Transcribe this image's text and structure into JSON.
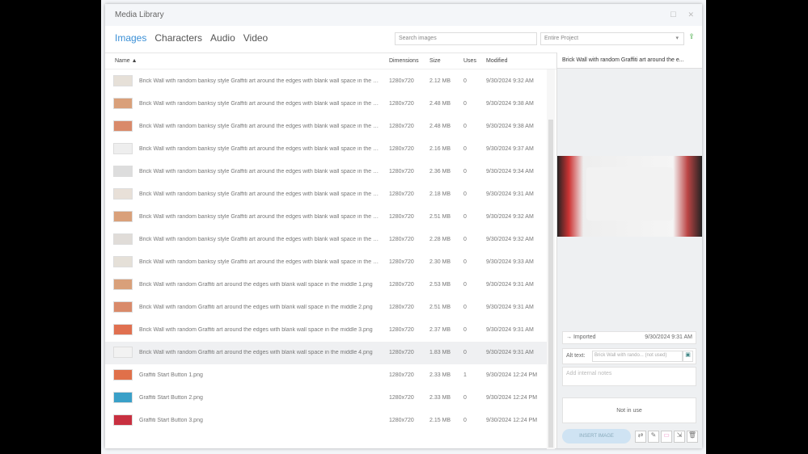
{
  "window": {
    "title": "Media Library",
    "maximize": "☐",
    "close": "✕"
  },
  "tabs": [
    {
      "label": "Images"
    },
    {
      "label": "Characters"
    },
    {
      "label": "Audio"
    },
    {
      "label": "Video"
    }
  ],
  "search": {
    "placeholder": "Search images"
  },
  "scope": {
    "value": "Entire Project"
  },
  "columns": {
    "name": "Name ▲",
    "dimensions": "Dimensions",
    "size": "Size",
    "uses": "Uses",
    "modified": "Modified"
  },
  "rows": [
    {
      "name": "Brick Wall with random banksy style Graffiti art around the edges with blank wall space in the mic...",
      "dim": "1280x720",
      "size": "2.12 MB",
      "uses": "0",
      "mod": "9/30/2024 9:32 AM"
    },
    {
      "name": "Brick Wall with random banksy style Graffiti art around the edges with blank wall space in the mic...",
      "dim": "1280x720",
      "size": "2.48 MB",
      "uses": "0",
      "mod": "9/30/2024 9:38 AM"
    },
    {
      "name": "Brick Wall with random banksy style Graffiti art around the edges with blank wall space in the mic...",
      "dim": "1280x720",
      "size": "2.48 MB",
      "uses": "0",
      "mod": "9/30/2024 9:38 AM"
    },
    {
      "name": "Brick Wall with random banksy style Graffiti art around the edges with blank wall space in the mic...",
      "dim": "1280x720",
      "size": "2.16 MB",
      "uses": "0",
      "mod": "9/30/2024 9:37 AM"
    },
    {
      "name": "Brick Wall with random banksy style Graffiti art around the edges with blank wall space in the mic...",
      "dim": "1280x720",
      "size": "2.36 MB",
      "uses": "0",
      "mod": "9/30/2024 9:34 AM"
    },
    {
      "name": "Brick Wall with random banksy style Graffiti art around the edges with blank wall space in the mic...",
      "dim": "1280x720",
      "size": "2.18 MB",
      "uses": "0",
      "mod": "9/30/2024 9:31 AM"
    },
    {
      "name": "Brick Wall with random banksy style Graffiti art around the edges with blank wall space in the mic...",
      "dim": "1280x720",
      "size": "2.51 MB",
      "uses": "0",
      "mod": "9/30/2024 9:32 AM"
    },
    {
      "name": "Brick Wall with random banksy style Graffiti art around the edges with blank wall space in the mic...",
      "dim": "1280x720",
      "size": "2.28 MB",
      "uses": "0",
      "mod": "9/30/2024 9:32 AM"
    },
    {
      "name": "Brick Wall with random banksy style Graffiti art around the edges with blank wall space in the mic...",
      "dim": "1280x720",
      "size": "2.30 MB",
      "uses": "0",
      "mod": "9/30/2024 9:33 AM"
    },
    {
      "name": "Brick Wall with random Graffiti art around the edges with blank wall space in the middle 1.png",
      "dim": "1280x720",
      "size": "2.53 MB",
      "uses": "0",
      "mod": "9/30/2024 9:31 AM"
    },
    {
      "name": "Brick Wall with random Graffiti art around the edges with blank wall space in the middle 2.png",
      "dim": "1280x720",
      "size": "2.51 MB",
      "uses": "0",
      "mod": "9/30/2024 9:31 AM"
    },
    {
      "name": "Brick Wall with random Graffiti art around the edges with blank wall space in the middle 3.png",
      "dim": "1280x720",
      "size": "2.37 MB",
      "uses": "0",
      "mod": "9/30/2024 9:31 AM"
    },
    {
      "name": "Brick Wall with random Graffiti art around the edges with blank wall space in the middle 4.png",
      "dim": "1280x720",
      "size": "1.83 MB",
      "uses": "0",
      "mod": "9/30/2024 9:31 AM"
    },
    {
      "name": "Graffiti Start Button 1.png",
      "dim": "1280x720",
      "size": "2.33 MB",
      "uses": "1",
      "mod": "9/30/2024 12:24 PM"
    },
    {
      "name": "Graffiti Start Button 2.png",
      "dim": "1280x720",
      "size": "2.33 MB",
      "uses": "0",
      "mod": "9/30/2024 12:24 PM"
    },
    {
      "name": "Graffiti Start Button 3.png",
      "dim": "1280x720",
      "size": "2.15 MB",
      "uses": "0",
      "mod": "9/30/2024 12:24 PM"
    }
  ],
  "selected_index": 12,
  "detail": {
    "title": "Brick Wall with random Graffiti art around the e...",
    "status": "Imported",
    "status_date": "9/30/2024 9:31 AM",
    "alt_label": "Alt text:",
    "alt_value": "Brick Wall with rando... (not used)",
    "notes_placeholder": "Add internal notes",
    "usage": "Not in use",
    "insert": "INSERT IMAGE"
  }
}
